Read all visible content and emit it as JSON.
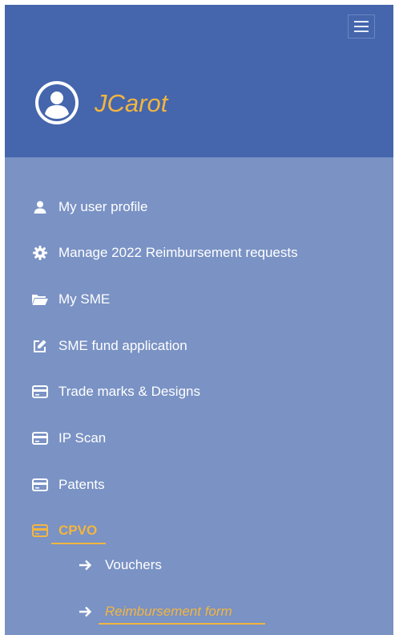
{
  "header": {
    "username": "JCarot",
    "menu_toggle_icon": "hamburger-icon",
    "avatar_icon": "user-circle-icon"
  },
  "menu": {
    "items": [
      {
        "label": "My user profile",
        "icon": "user-icon"
      },
      {
        "label": "Manage 2022 Reimbursement requests",
        "icon": "gear-icon"
      },
      {
        "label": "My SME",
        "icon": "folder-open-icon"
      },
      {
        "label": "SME fund application",
        "icon": "edit-icon"
      },
      {
        "label": "Trade marks & Designs",
        "icon": "card-icon"
      },
      {
        "label": "IP Scan",
        "icon": "card-icon"
      },
      {
        "label": "Patents",
        "icon": "card-icon"
      },
      {
        "label": "CPVO",
        "icon": "card-icon",
        "active": true
      }
    ],
    "subitems": [
      {
        "label": "Vouchers",
        "icon": "arrow-right-icon"
      },
      {
        "label": "Reimbursement form",
        "icon": "arrow-right-icon",
        "active": true
      }
    ]
  },
  "colors": {
    "header_bg": "#4566ad",
    "menu_bg": "#7a92c4",
    "accent": "#f3b53f",
    "text": "#ffffff"
  }
}
